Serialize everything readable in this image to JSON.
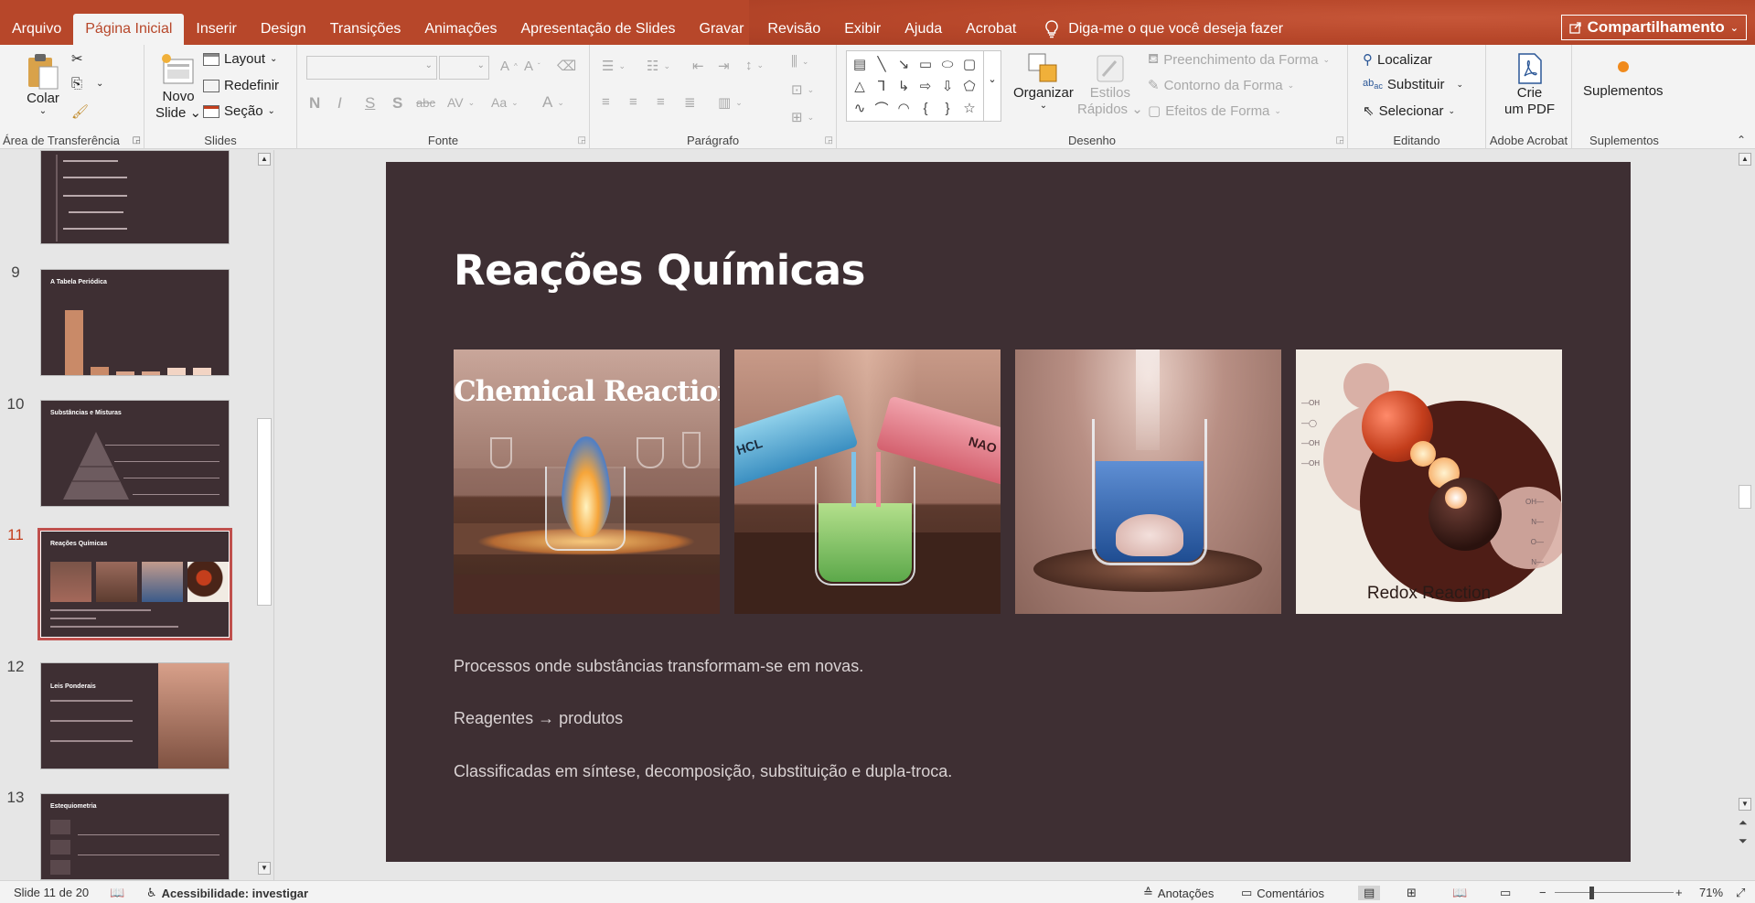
{
  "tabs": [
    "Arquivo",
    "Página Inicial",
    "Inserir",
    "Design",
    "Transições",
    "Animações",
    "Apresentação de Slides",
    "Gravar",
    "Revisão",
    "Exibir",
    "Ajuda",
    "Acrobat"
  ],
  "active_tab": "Página Inicial",
  "tell_me": "Diga-me o que você deseja fazer",
  "share": "Compartilhamento",
  "ribbon": {
    "clipboard": {
      "paste": "Colar",
      "label": "Área de Transferência"
    },
    "slides": {
      "new_slide_1": "Novo",
      "new_slide_2": "Slide",
      "layout": "Layout",
      "reset": "Redefinir",
      "section": "Seção",
      "label": "Slides"
    },
    "font": {
      "label": "Fonte",
      "bold": "N",
      "italic": "I",
      "underline": "S",
      "shadow": "S",
      "strike": "abc",
      "spacing": "AV",
      "case": "Aa"
    },
    "paragraph": {
      "label": "Parágrafo"
    },
    "drawing": {
      "arrange": "Organizar",
      "quick_styles_1": "Estilos",
      "quick_styles_2": "Rápidos",
      "fill": "Preenchimento da Forma",
      "outline": "Contorno da Forma",
      "effects": "Efeitos de Forma",
      "label": "Desenho"
    },
    "editing": {
      "find": "Localizar",
      "replace": "Substituir",
      "select": "Selecionar",
      "label": "Editando"
    },
    "acrobat": {
      "create_1": "Crie",
      "create_2": "um PDF",
      "label": "Adobe Acrobat"
    },
    "addins": {
      "button": "Suplementos",
      "label": "Suplementos"
    }
  },
  "thumbnails": [
    {
      "num": "",
      "title": ""
    },
    {
      "num": "9",
      "title": "A Tabela Periódica"
    },
    {
      "num": "10",
      "title": "Substâncias e Misturas"
    },
    {
      "num": "11",
      "title": "Reações Químicas"
    },
    {
      "num": "12",
      "title": "Leis Ponderais"
    },
    {
      "num": "13",
      "title": "Estequiometria"
    }
  ],
  "slide": {
    "title": "Reações Químicas",
    "images": [
      {
        "caption": "Chemical Reactions"
      },
      {
        "caption_left": "HCL",
        "caption_right": "NAO"
      },
      {
        "caption": ""
      },
      {
        "caption": "Redox Reaction"
      }
    ],
    "bullets": [
      "Processos onde substâncias transformam-se em novas.",
      "Reagentes → produtos",
      "Classificadas em síntese, decomposição, substituição e dupla-troca."
    ]
  },
  "status": {
    "slide_count": "Slide 11 de 20",
    "accessibility": "Acessibilidade: investigar",
    "notes": "Anotações",
    "comments": "Comentários",
    "zoom": "71%"
  },
  "colors": {
    "accent": "#b7472a",
    "slide_bg": "#3e2f33"
  }
}
